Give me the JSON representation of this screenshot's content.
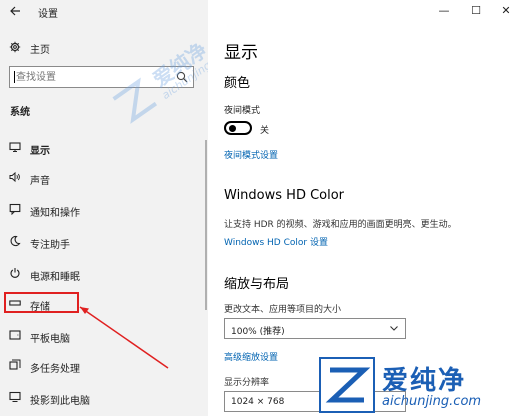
{
  "window": {
    "title": "设置",
    "controls": {
      "minimize": "—",
      "maximize": "☐",
      "close": "✕"
    }
  },
  "sidebar": {
    "home_label": "主页",
    "search": {
      "placeholder": "查找设置"
    },
    "section": "系统",
    "items": [
      {
        "label": "显示",
        "icon": "monitor-icon",
        "active": true
      },
      {
        "label": "声音",
        "icon": "speaker-icon"
      },
      {
        "label": "通知和操作",
        "icon": "notification-icon"
      },
      {
        "label": "专注助手",
        "icon": "moon-icon"
      },
      {
        "label": "电源和睡眠",
        "icon": "power-icon"
      },
      {
        "label": "存储",
        "icon": "storage-icon",
        "highlighted": true
      },
      {
        "label": "平板电脑",
        "icon": "tablet-icon"
      },
      {
        "label": "多任务处理",
        "icon": "multitask-icon"
      },
      {
        "label": "投影到此电脑",
        "icon": "project-icon"
      }
    ]
  },
  "main": {
    "title": "显示",
    "color": {
      "heading": "颜色",
      "night_light_label": "夜间模式",
      "toggle_state": "关",
      "night_light_settings_link": "夜间模式设置"
    },
    "hdr": {
      "heading": "Windows HD Color",
      "description": "让支持 HDR 的视频、游戏和应用的画面更明亮、更生动。",
      "settings_link": "Windows HD Color 设置"
    },
    "scale_layout": {
      "heading": "缩放与布局",
      "scale_label": "更改文本、应用等项目的大小",
      "scale_value": "100% (推荐)",
      "advanced_link": "高级缩放设置",
      "resolution_label": "显示分辨率",
      "resolution_value": "1024 × 768"
    }
  },
  "watermark": {
    "brand": "爱纯净",
    "url": "aichunjing.com"
  },
  "colors": {
    "accent_link": "#0063b1",
    "highlight": "#e02020",
    "sidebar_bg": "#f2f2f2",
    "watermark": "#1b5fb5"
  }
}
